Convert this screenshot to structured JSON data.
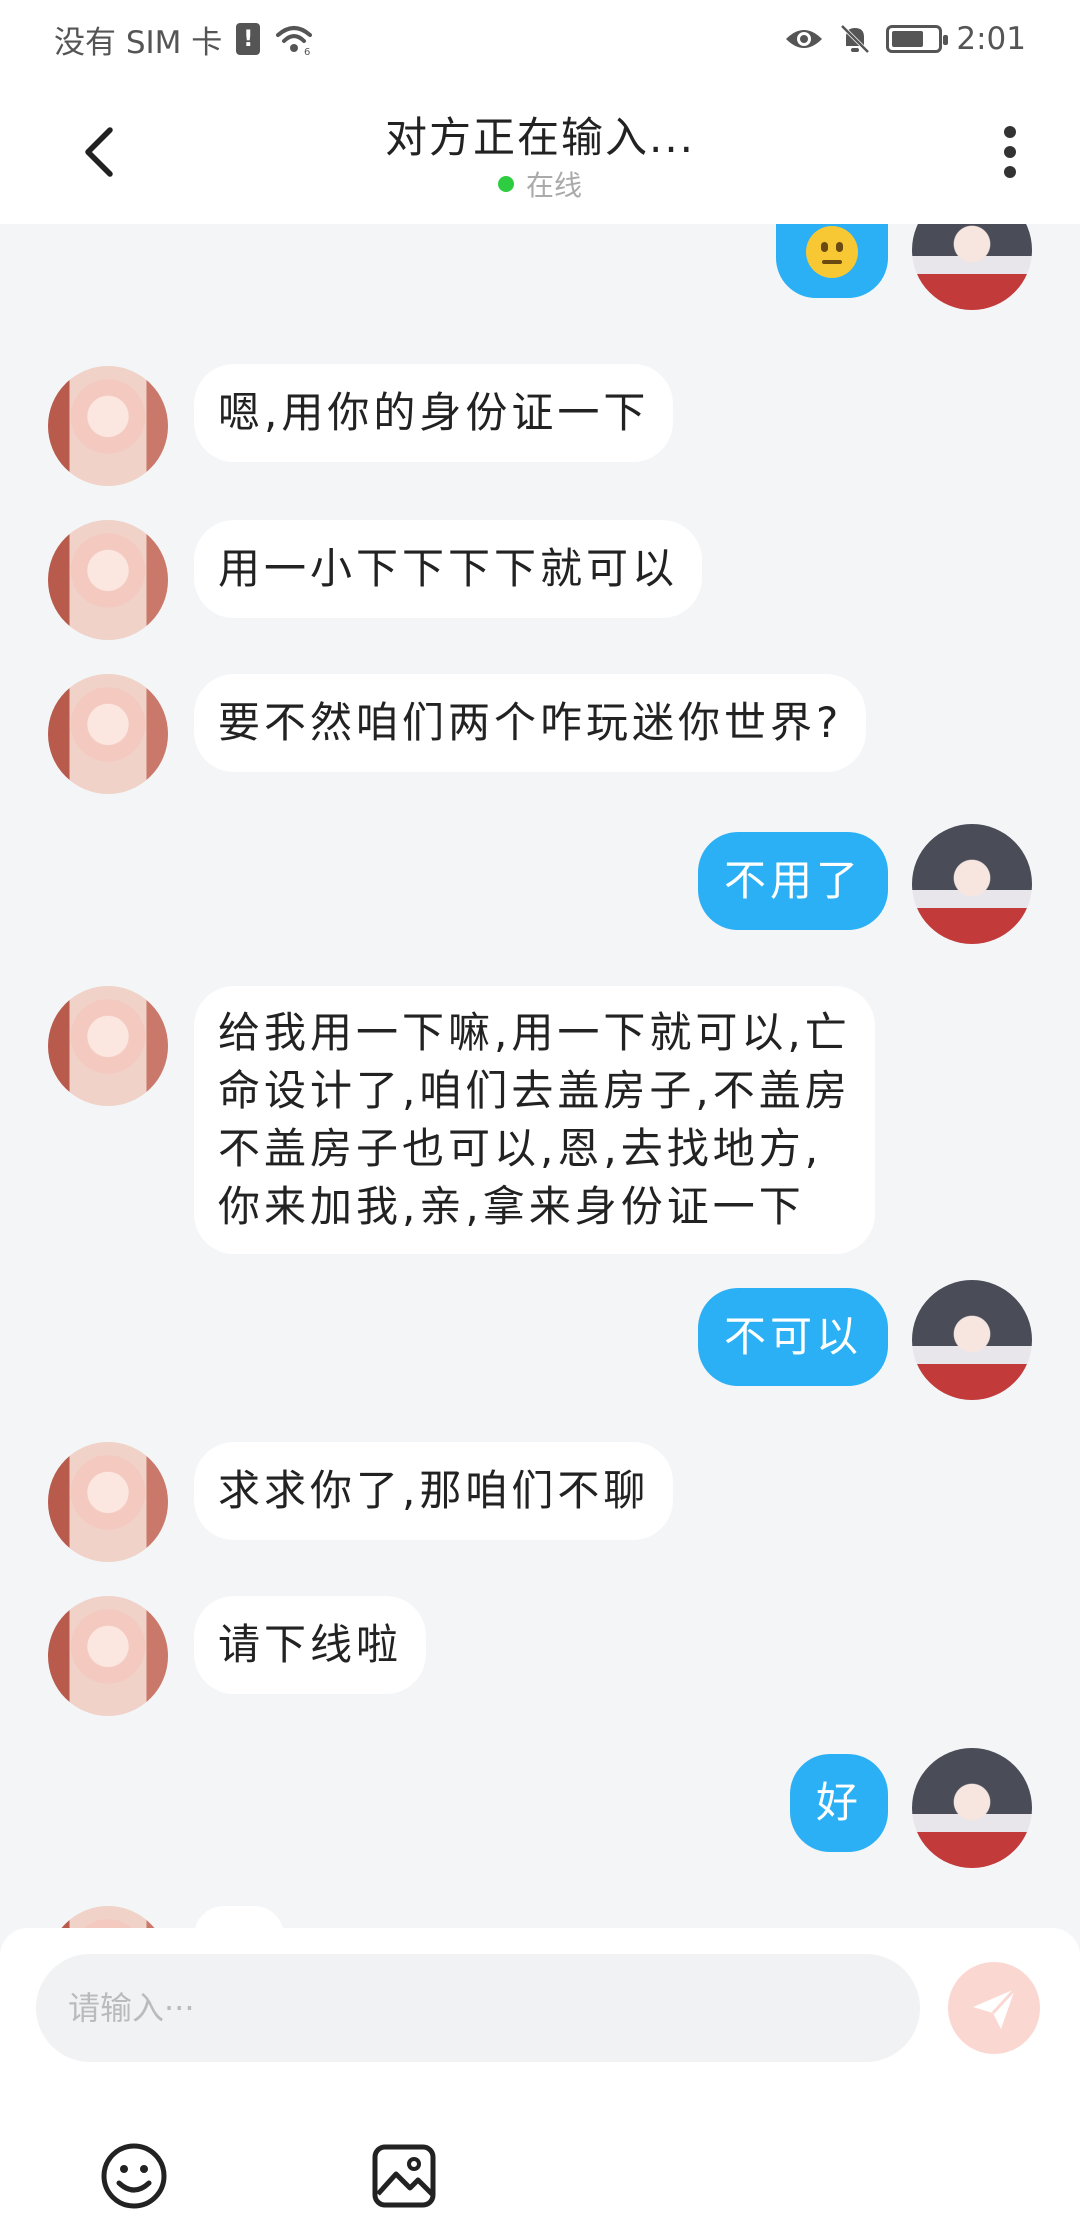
{
  "status_bar": {
    "carrier": "没有 SIM 卡",
    "sim_badge": "!",
    "time": "2:01",
    "battery_level": 0.7
  },
  "header": {
    "title": "对方正在输入...",
    "status": "在线",
    "back_icon": "chevron-left-icon",
    "more_icon": "more-vertical-icon"
  },
  "messages": [
    {
      "from": "me",
      "type": "emoji",
      "content": "neutral-face-emoji"
    },
    {
      "from": "them",
      "text": "嗯,用你的身份证一下"
    },
    {
      "from": "them",
      "text": "用一小下下下下就可以"
    },
    {
      "from": "them",
      "text": "要不然咱们两个咋玩迷你世界?"
    },
    {
      "from": "me",
      "text": "不用了"
    },
    {
      "from": "them",
      "lines": [
        "给我用一下嘛,用一下就可以,亡",
        "命设计了,咱们去盖房子,不盖房",
        "不盖房子也可以,恩,去找地方,",
        "你来加我,亲,拿来身份证一下"
      ]
    },
    {
      "from": "me",
      "text": "不可以"
    },
    {
      "from": "them",
      "text": "求求你了,那咱们不聊"
    },
    {
      "from": "them",
      "text": "请下线啦"
    },
    {
      "from": "me",
      "text": "好"
    }
  ],
  "input": {
    "placeholder": "请输入···",
    "send_icon": "send-icon",
    "emoji_icon": "smiley-icon",
    "image_icon": "image-icon"
  },
  "colors": {
    "accent": "#2bb0f5",
    "background": "#f4f5f7",
    "online": "#2ecc40",
    "send_disabled": "#fbd7d2"
  }
}
